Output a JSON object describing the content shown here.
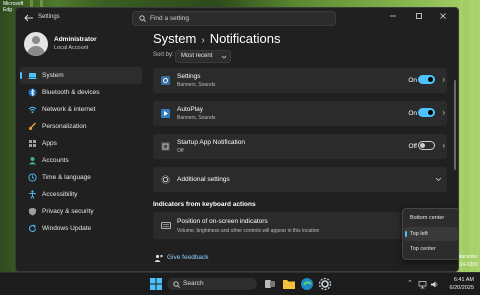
{
  "desktop": {
    "icon_label_line1": "Microsoft",
    "icon_label_line2": "Edg",
    "side_text_1": "atacenter",
    "side_text_2": "2614-0200"
  },
  "window": {
    "app_title": "Settings",
    "search_placeholder": "Find a setting"
  },
  "profile": {
    "name": "Administrator",
    "role": "Local Account"
  },
  "sidebar": {
    "items": [
      {
        "label": "System",
        "icon": "laptop-icon",
        "color": "#4cc2ff"
      },
      {
        "label": "Bluetooth & devices",
        "icon": "bluetooth-icon",
        "color": "#4cc2ff"
      },
      {
        "label": "Network & internet",
        "icon": "wifi-icon",
        "color": "#4cc2ff"
      },
      {
        "label": "Personalization",
        "icon": "brush-icon",
        "color": "#e8a23a"
      },
      {
        "label": "Apps",
        "icon": "apps-icon",
        "color": "#9aa0a6"
      },
      {
        "label": "Accounts",
        "icon": "person-icon",
        "color": "#3fb27f"
      },
      {
        "label": "Time & language",
        "icon": "globe-clock-icon",
        "color": "#4cc2ff"
      },
      {
        "label": "Accessibility",
        "icon": "accessibility-icon",
        "color": "#4cc2ff"
      },
      {
        "label": "Privacy & security",
        "icon": "shield-icon",
        "color": "#9aa0a6"
      },
      {
        "label": "Windows Update",
        "icon": "update-icon",
        "color": "#4cc2ff"
      }
    ]
  },
  "breadcrumb": {
    "parent": "System",
    "separator": "›",
    "current": "Notifications"
  },
  "sort": {
    "label": "Sort by:",
    "value": "Most recent"
  },
  "apps": [
    {
      "title": "Settings",
      "subtitle": "Banners, Sounds",
      "state": "On",
      "on": true
    },
    {
      "title": "AutoPlay",
      "subtitle": "Banners, Sounds",
      "state": "On",
      "on": true
    },
    {
      "title": "Startup App Notification",
      "subtitle": "Off",
      "state": "Off",
      "on": false
    }
  ],
  "additional": {
    "label": "Additional settings"
  },
  "keyboard_section": {
    "heading": "Indicators from keyboard actions",
    "title": "Position of on-screen indicators",
    "subtitle": "Volume, brightness and other controls will appear in this location"
  },
  "dropdown": {
    "options": [
      "Bottom center",
      "Top left",
      "Top center"
    ],
    "selected": "Top left"
  },
  "feedback": {
    "label": "Give feedback"
  },
  "taskbar": {
    "search_label": "Search",
    "time": "6:41 AM",
    "date": "6/20/2025"
  },
  "colors": {
    "accent": "#4cc2ff",
    "window_bg": "#202020",
    "card_bg": "#2b2b2b"
  }
}
